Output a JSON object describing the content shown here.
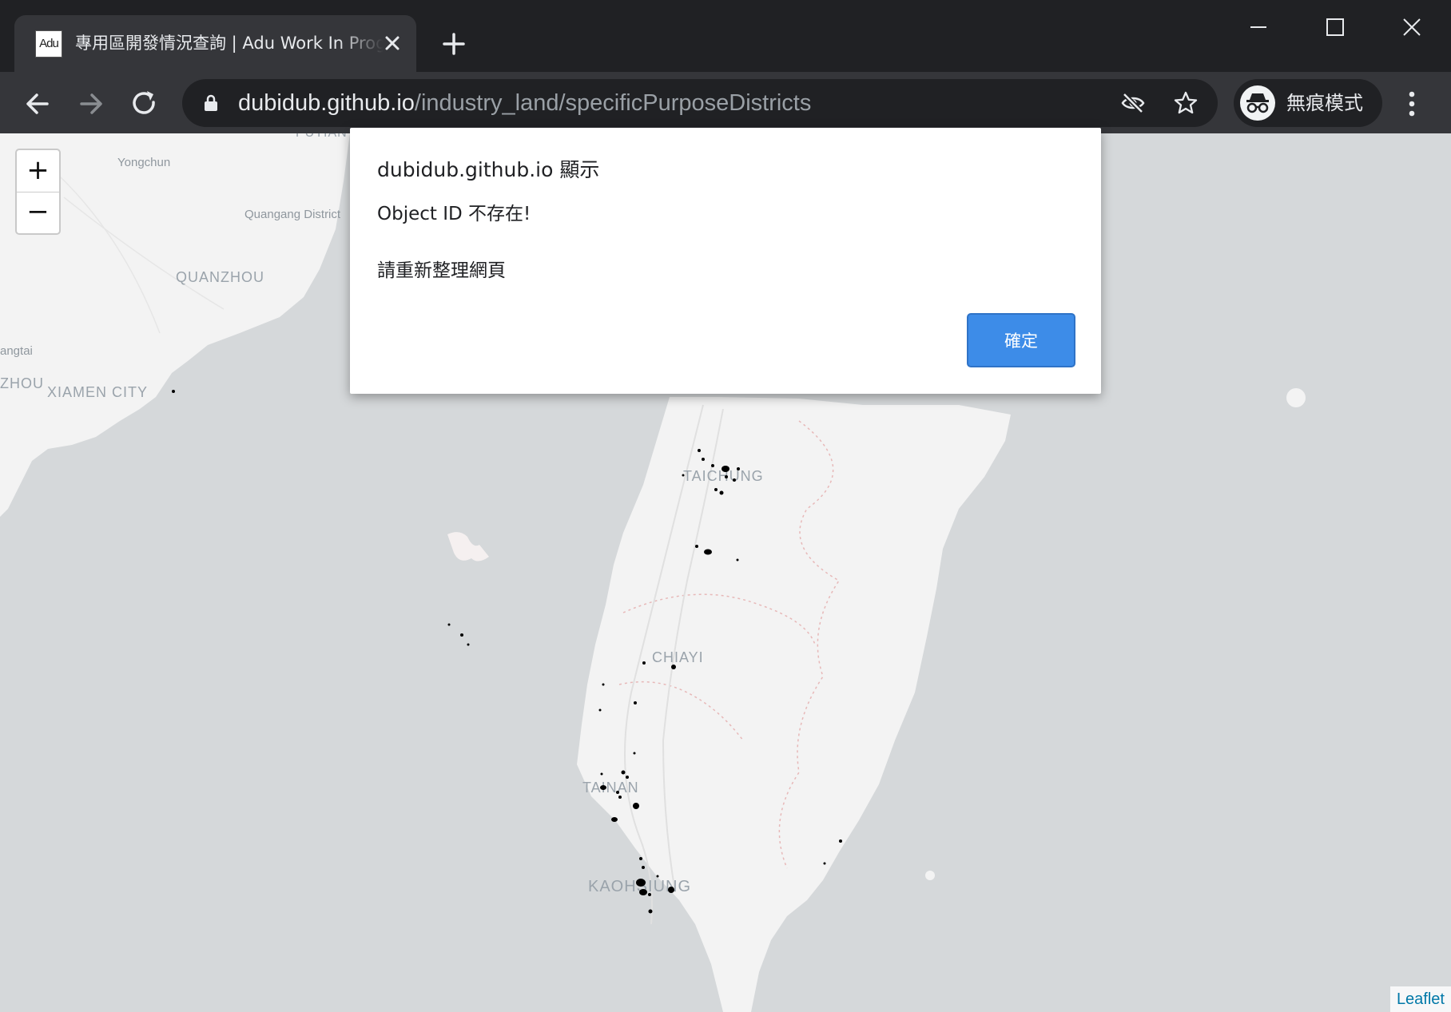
{
  "browser": {
    "tab": {
      "favicon_text": "Adu",
      "title": "專用區開發情況查詢 | Adu Work In Progress"
    },
    "address": {
      "host": "dubidub.github.io",
      "path": "/industry_land/specificPurposeDistricts"
    },
    "profile_label": "無痕模式",
    "icons": [
      "back-arrow-icon",
      "forward-arrow-icon",
      "reload-icon",
      "lock-icon",
      "eye-off-icon",
      "star-icon",
      "incognito-icon",
      "more-vert-icon",
      "close-icon",
      "plus-icon",
      "minimize-icon",
      "maximize-icon"
    ]
  },
  "map": {
    "labels": {
      "putian": "PUTIAN",
      "yongchun": "Yongchun",
      "quangang": "Quangang District",
      "quanzhou": "QUANZHOU",
      "angtai": "angtai",
      "zhou": "ZHOU",
      "xiamen": "XIAMEN CITY",
      "taichung": "TAICHUNG",
      "chiayi": "CHIAYI",
      "tainan": "TAINAN",
      "kaohsiung": "KAOHSIUNG"
    },
    "zoom_in_label": "+",
    "zoom_out_label": "−",
    "attribution": "Leaflet",
    "colors": {
      "land": "#f3f3f3",
      "water": "#d5d8da",
      "markers": "#000000"
    }
  },
  "dialog": {
    "title": "dubidub.github.io 顯示",
    "message_line1": "Object ID 不存在!",
    "message_line2": "請重新整理網頁",
    "ok_label": "確定",
    "ok_color": "#3d8ce8"
  }
}
